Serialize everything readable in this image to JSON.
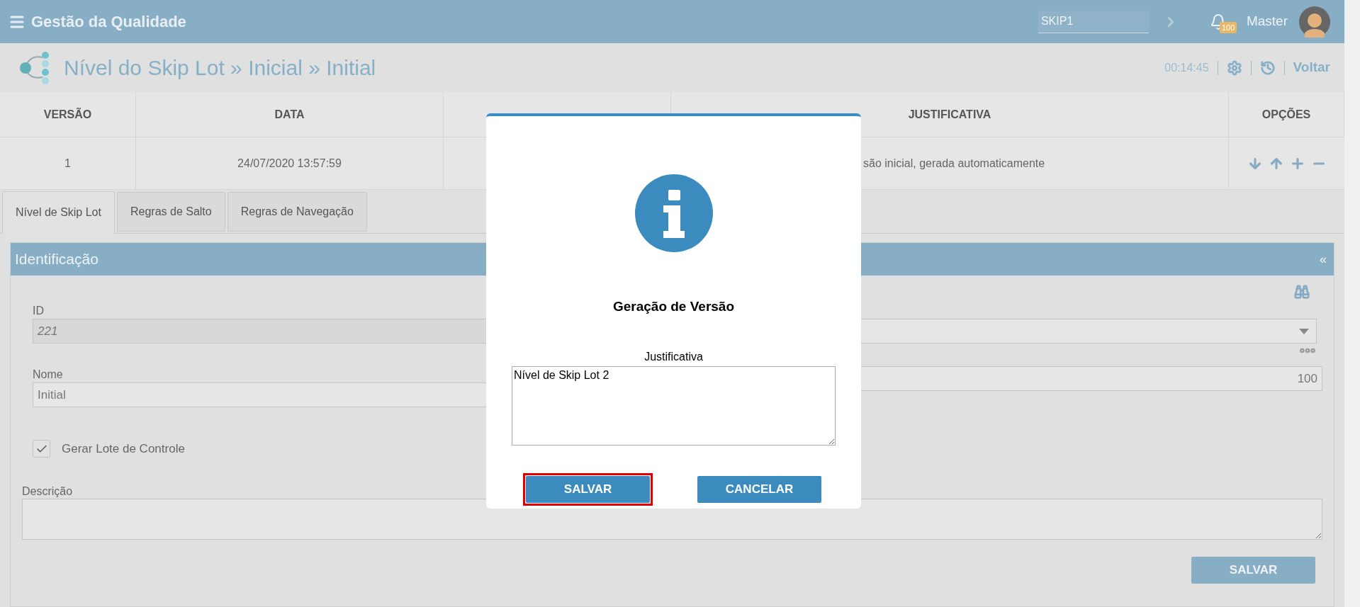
{
  "header": {
    "title": "Gestão da Qualidade",
    "search": {
      "value": "SKIP1"
    },
    "notifications": {
      "count": "100"
    },
    "user": {
      "name": "Master"
    }
  },
  "page": {
    "title": "Nível do Skip Lot » Inicial » Initial",
    "timer": "00:14:45",
    "back_link": "Voltar"
  },
  "versions_table": {
    "columns": [
      "VERSÃO",
      "DATA",
      "JUSTIFICATIVA",
      "OPÇÕES"
    ],
    "rows": [
      {
        "version": "1",
        "date": "24/07/2020 13:57:59",
        "justification": "são inicial, gerada automaticamente"
      }
    ]
  },
  "tabs": [
    {
      "label": "Nível de Skip Lot",
      "selected": true
    },
    {
      "label": "Regras de Salto",
      "selected": false
    },
    {
      "label": "Regras de Navegação",
      "selected": false
    }
  ],
  "section": {
    "title": "Identificação",
    "collapse": "«",
    "fields": [
      {
        "label": "ID",
        "value": "221",
        "kind": "readonly"
      },
      {
        "label": "Nome",
        "value": "Initial",
        "kind": "text"
      }
    ],
    "right_number": {
      "value": "100"
    },
    "checkbox": {
      "label": "Gerar Lote de Controle",
      "checked": true
    },
    "description": {
      "label": "Descrição"
    },
    "save_button": "SALVAR"
  },
  "dialog": {
    "title": "Geração de Versão",
    "field_label": "Justificativa",
    "field_value": "Nível de Skip Lot 2",
    "buttons": [
      {
        "label": "SALVAR",
        "highlighted": true
      },
      {
        "label": "CANCELAR",
        "highlighted": false
      }
    ]
  }
}
